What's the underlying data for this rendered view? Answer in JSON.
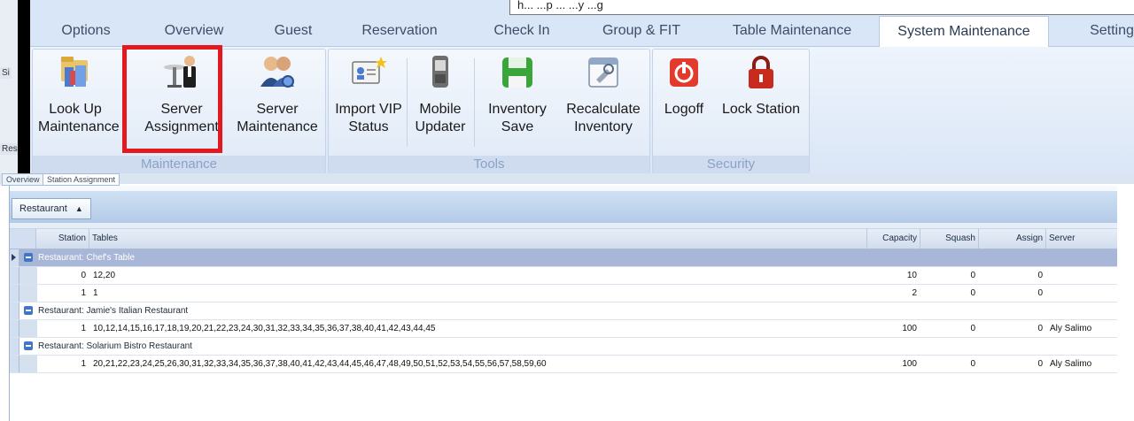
{
  "title_popup": "h... ...p ... ...y ...g",
  "background_fragments": [
    "Si",
    "Res"
  ],
  "tabs": [
    "Options",
    "Overview",
    "Guest",
    "Reservation",
    "Check In",
    "Group & FIT",
    "Table Maintenance",
    "System Maintenance",
    "Setting"
  ],
  "active_tab": "System Maintenance",
  "groups": {
    "maintenance": {
      "label": "Maintenance",
      "buttons": [
        {
          "line1": "Look Up",
          "line2": "Maintenance",
          "icon": "lookup-maintenance-icon"
        },
        {
          "line1": "Server",
          "line2": "Assignment",
          "icon": "server-assignment-icon"
        },
        {
          "line1": "Server",
          "line2": "Maintenance",
          "icon": "server-maintenance-icon"
        }
      ]
    },
    "tools": {
      "label": "Tools",
      "buttons": [
        {
          "line1": "Import VIP",
          "line2": "Status",
          "icon": "vip-card-icon"
        },
        {
          "line1": "Mobile",
          "line2": "Updater",
          "icon": "mobile-device-icon"
        },
        {
          "line1": "Inventory",
          "line2": "Save",
          "icon": "save-disk-icon"
        },
        {
          "line1": "Recalculate",
          "line2": "Inventory",
          "icon": "recalculate-calendar-icon"
        }
      ]
    },
    "security": {
      "label": "Security",
      "buttons": [
        {
          "line1": "Logoff",
          "line2": "",
          "icon": "power-icon"
        },
        {
          "line1": "Lock Station",
          "line2": "",
          "icon": "lock-icon"
        }
      ]
    }
  },
  "doc_tabs": [
    "Overview",
    "Station Assignment"
  ],
  "grid": {
    "group_by": "Restaurant",
    "columns": [
      "Station",
      "Tables",
      "Capacity",
      "Squash",
      "Assign",
      "Server"
    ],
    "groups": [
      {
        "title": "Restaurant: Chef's Table",
        "selected": true,
        "rows": [
          {
            "station": "0",
            "tables": "12,20",
            "capacity": "10",
            "squash": "0",
            "assign": "0",
            "server": ""
          },
          {
            "station": "1",
            "tables": "1",
            "capacity": "2",
            "squash": "0",
            "assign": "0",
            "server": ""
          }
        ]
      },
      {
        "title": "Restaurant: Jamie's Italian Restaurant",
        "selected": false,
        "rows": [
          {
            "station": "1",
            "tables": "10,12,14,15,16,17,18,19,20,21,22,23,24,30,31,32,33,34,35,36,37,38,40,41,42,43,44,45",
            "capacity": "100",
            "squash": "0",
            "assign": "0",
            "server": "Aly Salimo"
          }
        ]
      },
      {
        "title": "Restaurant: Solarium Bistro Restaurant",
        "selected": false,
        "rows": [
          {
            "station": "1",
            "tables": "20,21,22,23,24,25,26,30,31,32,33,34,35,36,37,38,40,41,42,43,44,45,46,47,48,49,50,51,52,53,54,55,56,57,58,59,60",
            "capacity": "100",
            "squash": "0",
            "assign": "0",
            "server": "Aly Salimo"
          }
        ]
      }
    ]
  },
  "colors": {
    "highlight": "#e4181f",
    "group_selected": "#a8b6d8",
    "ribbon_bg": "#dae6f6"
  }
}
